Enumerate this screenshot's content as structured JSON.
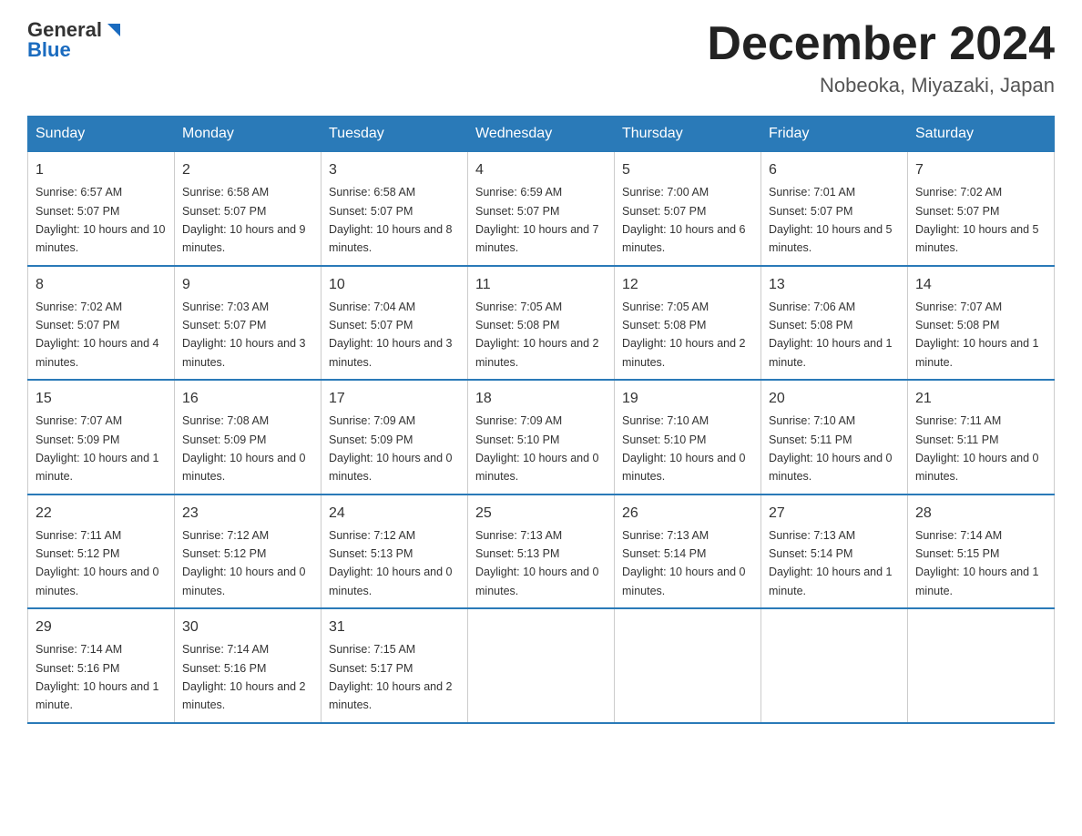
{
  "header": {
    "logo_general": "General",
    "logo_blue": "Blue",
    "title": "December 2024",
    "location": "Nobeoka, Miyazaki, Japan"
  },
  "days_of_week": [
    "Sunday",
    "Monday",
    "Tuesday",
    "Wednesday",
    "Thursday",
    "Friday",
    "Saturday"
  ],
  "weeks": [
    [
      {
        "day": "1",
        "sunrise": "6:57 AM",
        "sunset": "5:07 PM",
        "daylight": "10 hours and 10 minutes."
      },
      {
        "day": "2",
        "sunrise": "6:58 AM",
        "sunset": "5:07 PM",
        "daylight": "10 hours and 9 minutes."
      },
      {
        "day": "3",
        "sunrise": "6:58 AM",
        "sunset": "5:07 PM",
        "daylight": "10 hours and 8 minutes."
      },
      {
        "day": "4",
        "sunrise": "6:59 AM",
        "sunset": "5:07 PM",
        "daylight": "10 hours and 7 minutes."
      },
      {
        "day": "5",
        "sunrise": "7:00 AM",
        "sunset": "5:07 PM",
        "daylight": "10 hours and 6 minutes."
      },
      {
        "day": "6",
        "sunrise": "7:01 AM",
        "sunset": "5:07 PM",
        "daylight": "10 hours and 5 minutes."
      },
      {
        "day": "7",
        "sunrise": "7:02 AM",
        "sunset": "5:07 PM",
        "daylight": "10 hours and 5 minutes."
      }
    ],
    [
      {
        "day": "8",
        "sunrise": "7:02 AM",
        "sunset": "5:07 PM",
        "daylight": "10 hours and 4 minutes."
      },
      {
        "day": "9",
        "sunrise": "7:03 AM",
        "sunset": "5:07 PM",
        "daylight": "10 hours and 3 minutes."
      },
      {
        "day": "10",
        "sunrise": "7:04 AM",
        "sunset": "5:07 PM",
        "daylight": "10 hours and 3 minutes."
      },
      {
        "day": "11",
        "sunrise": "7:05 AM",
        "sunset": "5:08 PM",
        "daylight": "10 hours and 2 minutes."
      },
      {
        "day": "12",
        "sunrise": "7:05 AM",
        "sunset": "5:08 PM",
        "daylight": "10 hours and 2 minutes."
      },
      {
        "day": "13",
        "sunrise": "7:06 AM",
        "sunset": "5:08 PM",
        "daylight": "10 hours and 1 minute."
      },
      {
        "day": "14",
        "sunrise": "7:07 AM",
        "sunset": "5:08 PM",
        "daylight": "10 hours and 1 minute."
      }
    ],
    [
      {
        "day": "15",
        "sunrise": "7:07 AM",
        "sunset": "5:09 PM",
        "daylight": "10 hours and 1 minute."
      },
      {
        "day": "16",
        "sunrise": "7:08 AM",
        "sunset": "5:09 PM",
        "daylight": "10 hours and 0 minutes."
      },
      {
        "day": "17",
        "sunrise": "7:09 AM",
        "sunset": "5:09 PM",
        "daylight": "10 hours and 0 minutes."
      },
      {
        "day": "18",
        "sunrise": "7:09 AM",
        "sunset": "5:10 PM",
        "daylight": "10 hours and 0 minutes."
      },
      {
        "day": "19",
        "sunrise": "7:10 AM",
        "sunset": "5:10 PM",
        "daylight": "10 hours and 0 minutes."
      },
      {
        "day": "20",
        "sunrise": "7:10 AM",
        "sunset": "5:11 PM",
        "daylight": "10 hours and 0 minutes."
      },
      {
        "day": "21",
        "sunrise": "7:11 AM",
        "sunset": "5:11 PM",
        "daylight": "10 hours and 0 minutes."
      }
    ],
    [
      {
        "day": "22",
        "sunrise": "7:11 AM",
        "sunset": "5:12 PM",
        "daylight": "10 hours and 0 minutes."
      },
      {
        "day": "23",
        "sunrise": "7:12 AM",
        "sunset": "5:12 PM",
        "daylight": "10 hours and 0 minutes."
      },
      {
        "day": "24",
        "sunrise": "7:12 AM",
        "sunset": "5:13 PM",
        "daylight": "10 hours and 0 minutes."
      },
      {
        "day": "25",
        "sunrise": "7:13 AM",
        "sunset": "5:13 PM",
        "daylight": "10 hours and 0 minutes."
      },
      {
        "day": "26",
        "sunrise": "7:13 AM",
        "sunset": "5:14 PM",
        "daylight": "10 hours and 0 minutes."
      },
      {
        "day": "27",
        "sunrise": "7:13 AM",
        "sunset": "5:14 PM",
        "daylight": "10 hours and 1 minute."
      },
      {
        "day": "28",
        "sunrise": "7:14 AM",
        "sunset": "5:15 PM",
        "daylight": "10 hours and 1 minute."
      }
    ],
    [
      {
        "day": "29",
        "sunrise": "7:14 AM",
        "sunset": "5:16 PM",
        "daylight": "10 hours and 1 minute."
      },
      {
        "day": "30",
        "sunrise": "7:14 AM",
        "sunset": "5:16 PM",
        "daylight": "10 hours and 2 minutes."
      },
      {
        "day": "31",
        "sunrise": "7:15 AM",
        "sunset": "5:17 PM",
        "daylight": "10 hours and 2 minutes."
      },
      null,
      null,
      null,
      null
    ]
  ],
  "labels": {
    "sunrise_prefix": "Sunrise: ",
    "sunset_prefix": "Sunset: ",
    "daylight_prefix": "Daylight: "
  }
}
